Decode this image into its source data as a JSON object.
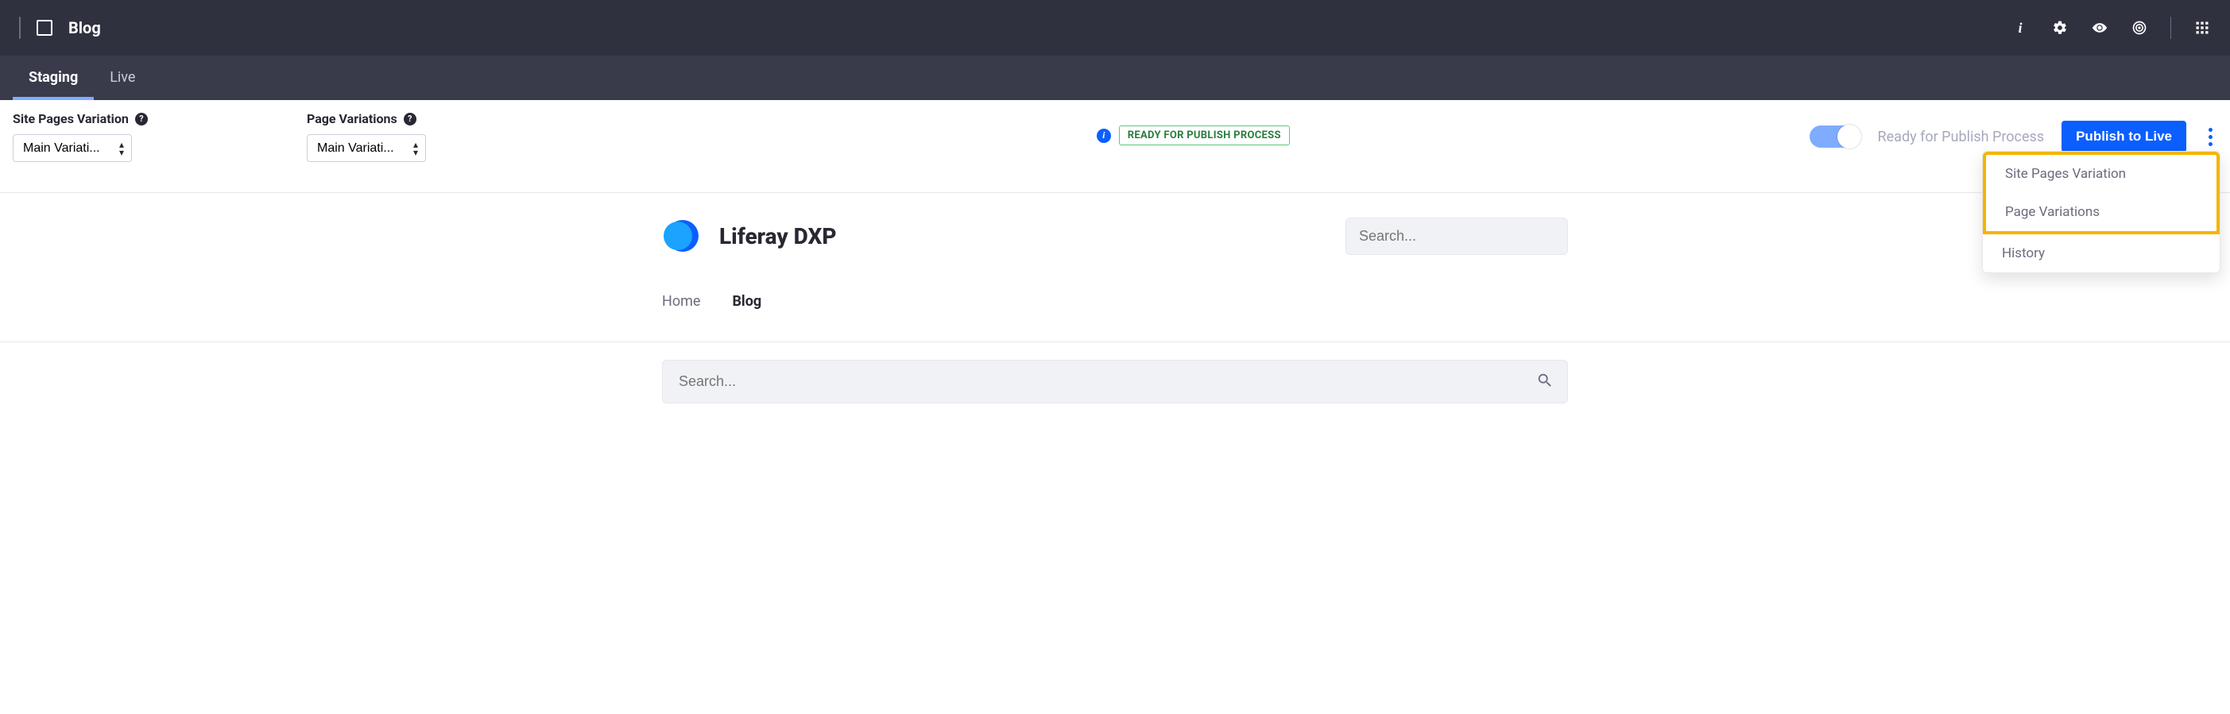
{
  "topbar": {
    "title": "Blog"
  },
  "tabs": {
    "staging": "Staging",
    "live": "Live"
  },
  "controls": {
    "site_pages_variation": {
      "label": "Site Pages Variation",
      "selected": "Main Variati..."
    },
    "page_variations": {
      "label": "Page Variations",
      "selected": "Main Variati..."
    },
    "status_badge": "READY FOR PUBLISH PROCESS",
    "toggle_label": "Ready for Publish Process",
    "publish_button": "Publish to Live"
  },
  "dropdown": {
    "site_pages_variation": "Site Pages Variation",
    "page_variations": "Page Variations",
    "history": "History"
  },
  "brand": {
    "name": "Liferay DXP",
    "search_placeholder": "Search..."
  },
  "nav": {
    "home": "Home",
    "blog": "Blog"
  },
  "page_search": {
    "placeholder": "Search..."
  }
}
